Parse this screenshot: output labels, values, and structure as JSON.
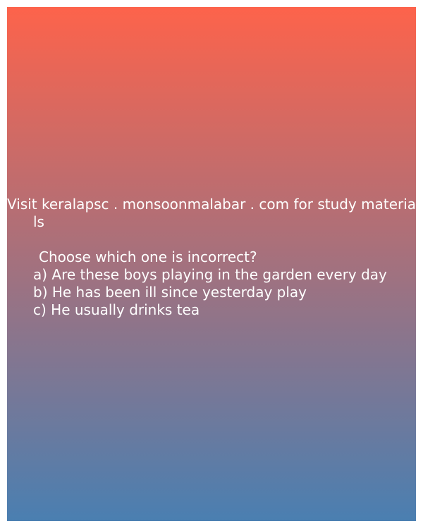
{
  "promo": {
    "line1": "Visit keralapsc . monsoonmalabar . com for study materia",
    "line2": "ls"
  },
  "question": {
    "prompt": "Choose which one is incorrect?",
    "options": [
      "a) Are these boys playing in the garden every day",
      "b) He has been ill since yesterday play",
      "c) He usually drinks tea"
    ]
  },
  "colors": {
    "gradient_top": "#fd634b",
    "gradient_bottom": "#4a7fb1",
    "text": "#ffffff"
  }
}
